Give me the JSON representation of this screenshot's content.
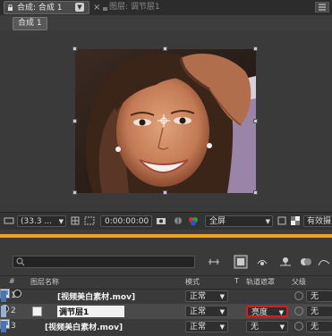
{
  "tabs": {
    "composition": "合成: 合成 1",
    "close_glyph": "×",
    "layer": "图层: 调节层1"
  },
  "breadcrumb": "合成 1",
  "viewer_toolbar": {
    "zoom": "(33.3 ...",
    "timecode": "0:00:00:00",
    "resolution": "全屏",
    "view_label": "有效摄"
  },
  "timeline": {
    "columns": {
      "num": "#",
      "source_name": "图层名称",
      "mode": "模式",
      "t": "T",
      "track_matte": "轨道遮罩",
      "parent": "父级"
    },
    "layers": [
      {
        "num": "1",
        "name": "[视频美白素材.mov]",
        "mode": "正常",
        "matte": "",
        "parent": "无",
        "label_color": "#4a73b8",
        "highlight": false
      },
      {
        "num": "2",
        "name": "调节层1",
        "mode": "正常",
        "matte": "亮度",
        "parent": "无",
        "label_color": "#9ab0d0",
        "highlight": true
      },
      {
        "num": "3",
        "name": "[视频美白素材.mov]",
        "mode": "正常",
        "matte": "无",
        "parent": "无",
        "label_color": "#4a73b8",
        "highlight": false
      }
    ]
  },
  "colors": {
    "accent_orange": "#f0a020",
    "highlight_red": "#d02020"
  }
}
